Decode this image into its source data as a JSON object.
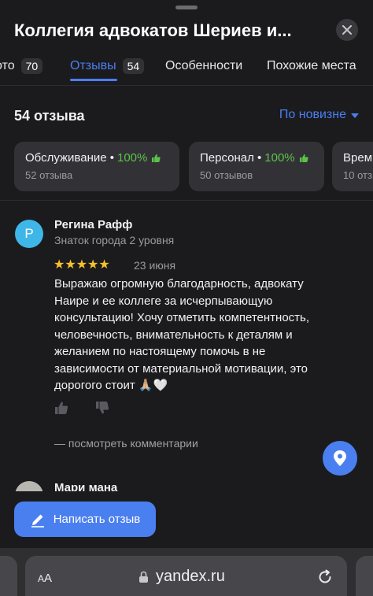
{
  "header": {
    "title": "Коллегия адвокатов Шериев и...",
    "close_icon": "close-icon"
  },
  "tabs": [
    {
      "label": "Фото",
      "visible_label": "ото",
      "count": "70",
      "active": false
    },
    {
      "label": "Отзывы",
      "count": "54",
      "active": true
    },
    {
      "label": "Особенности",
      "active": false
    },
    {
      "label": "Похожие места",
      "active": false
    }
  ],
  "reviews": {
    "count_label": "54 отзыва",
    "sort_label": "По новизне"
  },
  "aspects": [
    {
      "name": "Обслуживание",
      "percent": "100%",
      "sub": "52 отзыва"
    },
    {
      "name": "Персонал",
      "percent": "100%",
      "sub": "50 отзывов"
    },
    {
      "name": "Врем",
      "percent": "",
      "sub": "10 отз"
    }
  ],
  "review1": {
    "avatar_letter": "Р",
    "author": "Регина Рафф",
    "level": "Знаток города 2 уровня",
    "rating": 5,
    "stars": "★★★★★",
    "date": "23 июня",
    "text": "Выражаю огромную благодарность, адвокату Наире и ее коллеге за исчерпывающую консультацию! Хочу отметить компетентность, человечность, внимательность к деталям и желанием по настоящему помочь в не зависимости от материальной мотивации, это дорогого стоит 🙏🏼🤍",
    "comments_link": "— посмотреть комментарии"
  },
  "review2": {
    "author": "Мари мана"
  },
  "write_review_label": "Написать отзыв",
  "browser": {
    "aa_small": "A",
    "aa_large": "A",
    "url": "yandex.ru"
  },
  "colors": {
    "background": "#1b1b1e",
    "accent": "#4a7ff0",
    "positive": "#5cc24a",
    "star": "#f6c12a",
    "card": "#323236"
  }
}
